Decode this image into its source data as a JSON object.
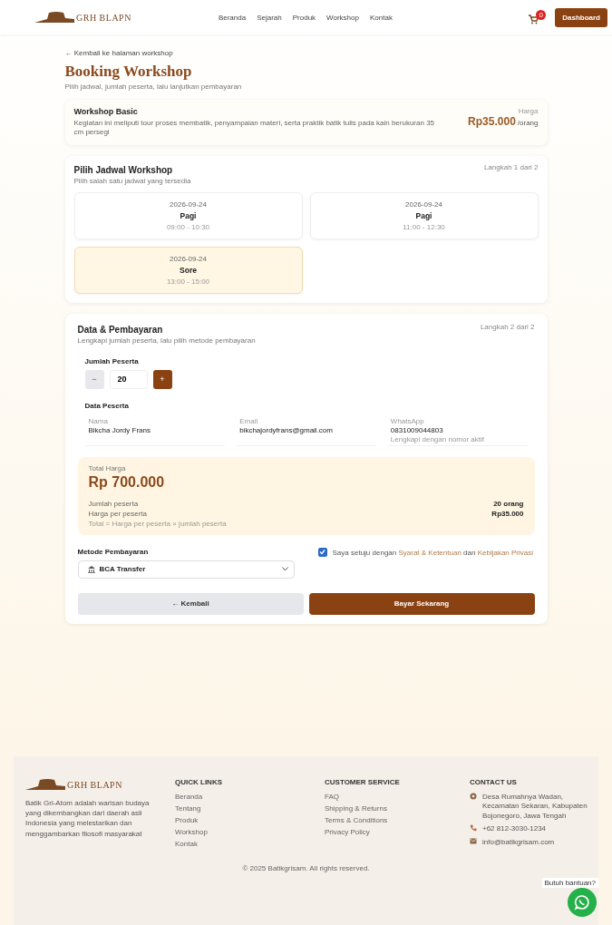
{
  "header": {
    "logo": "GRH BLAPN",
    "nav": [
      {
        "label": "Beranda"
      },
      {
        "label": "Sejarah"
      },
      {
        "label": "Produk"
      },
      {
        "label": "Workshop"
      },
      {
        "label": "Kontak"
      }
    ],
    "cart_count": "0",
    "dashboard": "Dashboard"
  },
  "back_link": "← Kembali ke halaman workshop",
  "title": "Booking Workshop",
  "subtitle": "Pilih jadwal, jumlah peserta, lalu lanjutkan pembayaran",
  "workshop": {
    "name": "Workshop Basic",
    "description": "Kegiatan ini meliputi tour proses membatik, penyampaian materi, serta praktik batik tulis pada kain berukuran 35 cm persegi",
    "price_label": "Harga",
    "price": "Rp35.000",
    "unit": "/orang"
  },
  "schedule": {
    "title": "Pilih Jadwal Workshop",
    "step": "Langkah 1 dari 2",
    "hint": "Pilih salah satu jadwal yang tersedia",
    "slots": [
      {
        "date": "2026-09-24",
        "session": "Pagi",
        "time": "09:00 - 10:30",
        "selected": false
      },
      {
        "date": "2026-09-24",
        "session": "Pagi",
        "time": "11:00 - 12:30",
        "selected": false
      },
      {
        "date": "2026-09-24",
        "session": "Sore",
        "time": "13:00 - 15:00",
        "selected": true
      }
    ]
  },
  "payment": {
    "title": "Data & Pembayaran",
    "step": "Langkah 2 dari 2",
    "hint": "Lengkapi jumlah peserta, lalu pilih metode pembayaran",
    "count_label": "Jumlah Peserta",
    "minus": "−",
    "count": "20",
    "plus": "+",
    "participants_label": "Data Peserta",
    "fields": [
      {
        "label": "Nama",
        "value": "Bikcha Jordy Frans"
      },
      {
        "label": "Email",
        "value": "bikchajordyfrans@gmail.com"
      },
      {
        "label": "WhatsApp",
        "value": "0831009044803",
        "hint": "Lengkapi dengan nomor aktif"
      }
    ],
    "total_label": "Total Harga",
    "total": "Rp 700.000",
    "summary": [
      {
        "label": "Jumlah peserta",
        "value": "20 orang"
      },
      {
        "label": "Harga per peserta",
        "value": "Rp35.000"
      }
    ],
    "summary_note": "Total = Harga per peserta × jumlah peserta",
    "method_label": "Metode Pembayaran",
    "method": "BCA Transfer",
    "agree": {
      "checked": true,
      "text": "Saya setuju dengan ",
      "link1": "Syarat & Ketentuan",
      "mid": " dan ",
      "link2": "Kebijakan Privasi"
    },
    "back": "← Kembali",
    "submit": "Bayar Sekarang"
  },
  "footer": {
    "logo": "GRH BLAPN",
    "about": "Batik Gri-Atom adalah warisan budaya yang dikembangkan dari daerah asli Indonesia yang melestarikan dan menggambarkan filosofi masyarakat",
    "columns": [
      {
        "title": "QUICK LINKS",
        "links": [
          "Beranda",
          "Tentang",
          "Produk",
          "Workshop",
          "Kontak"
        ]
      },
      {
        "title": "CUSTOMER SERVICE",
        "links": [
          "FAQ",
          "Shipping & Returns",
          "Terms & Conditions",
          "Privacy Policy"
        ]
      }
    ],
    "contact_title": "CONTACT US",
    "contacts": [
      {
        "kind": "address",
        "text": "Desa Rumahnya Wadan, Kecamatan Sekaran, Kabupaten Bojonegoro, Jawa Tengah"
      },
      {
        "kind": "phone",
        "text": "+62 812-3030-1234"
      },
      {
        "kind": "email",
        "text": "info@batikgrisam.com"
      }
    ],
    "copyright": "© 2025 Batikgrisam. All rights reserved.",
    "help": "Butuh bantuan?"
  }
}
